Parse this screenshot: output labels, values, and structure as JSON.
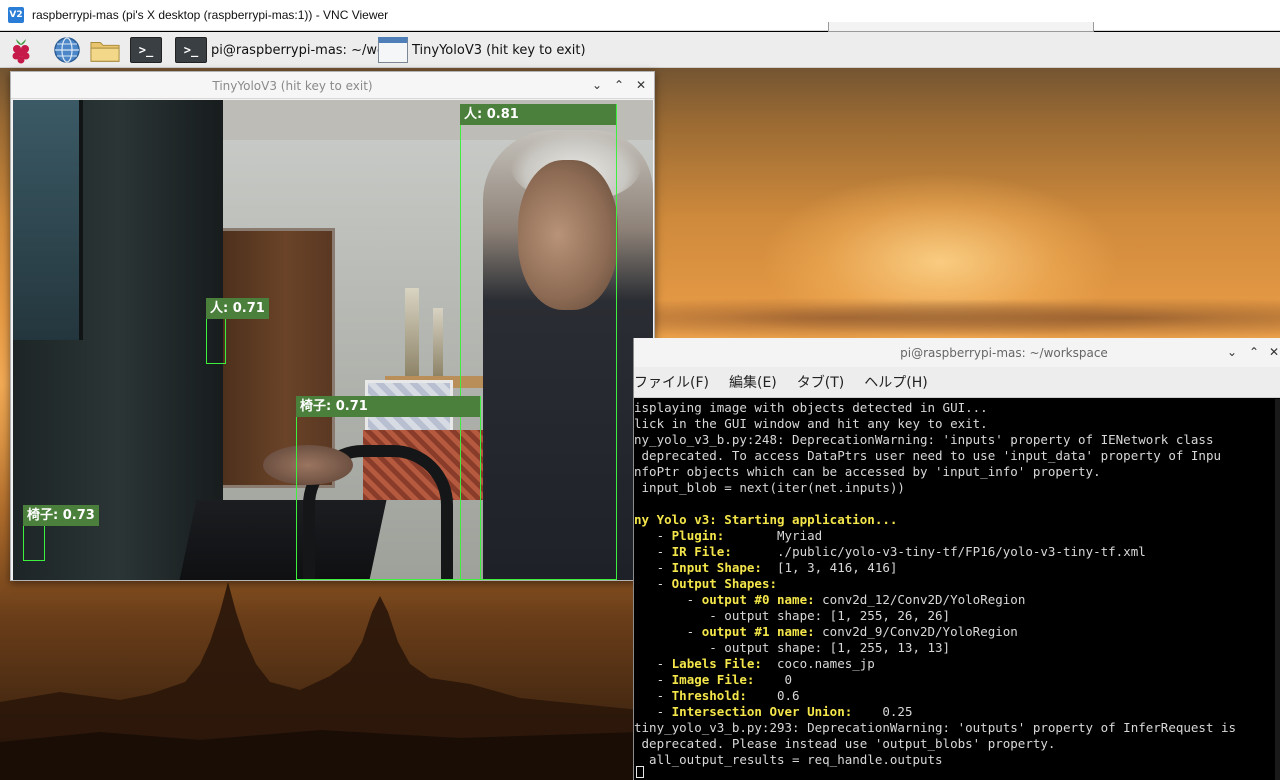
{
  "vnc": {
    "title": "raspberrypi-mas (pi's X desktop (raspberrypi-mas:1)) - VNC Viewer",
    "logo_text": "V2"
  },
  "taskbar": {
    "terminal_glyph": ">_",
    "terminal_window_label": "pi@raspberrypi-mas: ~/wo...",
    "yolo_window_label": "TinyYoloV3 (hit key to exit)"
  },
  "yolo_window": {
    "title": "TinyYoloV3 (hit key to exit)",
    "controls": {
      "minimize": "⌄",
      "maximize": "⌃",
      "close": "✕"
    },
    "detections": [
      {
        "label": "人: 0.81"
      },
      {
        "label": "人: 0.71"
      },
      {
        "label": "椅子: 0.71"
      },
      {
        "label": "椅子: 0.73"
      }
    ],
    "detection_color": "#3df03d",
    "label_bg": "#4b7f3c"
  },
  "terminal": {
    "title": "pi@raspberrypi-mas: ~/workspace",
    "controls": {
      "minimize": "⌄",
      "maximize": "⌃",
      "close": "✕"
    },
    "menu": [
      "ファイル(F)",
      "編集(E)",
      "タブ(T)",
      "ヘルプ(H)"
    ],
    "lines": [
      {
        "prefix": "",
        "hl": "",
        "rest": "isplaying image with objects detected in GUI..."
      },
      {
        "prefix": "",
        "hl": "",
        "rest": "lick in the GUI window and hit any key to exit."
      },
      {
        "prefix": "",
        "hl": "",
        "rest": "ny_yolo_v3_b.py:248: DeprecationWarning: 'inputs' property of IENetwork class"
      },
      {
        "prefix": "",
        "hl": "",
        "rest": " deprecated. To access DataPtrs user need to use 'input_data' property of Inpu"
      },
      {
        "prefix": "",
        "hl": "",
        "rest": "nfoPtr objects which can be accessed by 'input_info' property."
      },
      {
        "prefix": "",
        "hl": "",
        "rest": " input_blob = next(iter(net.inputs))"
      },
      {
        "prefix": "",
        "hl": "",
        "rest": ""
      },
      {
        "prefix": "",
        "hl": "ny Yolo v3: Starting application...",
        "rest": ""
      },
      {
        "prefix": "   - ",
        "hl": "Plugin:",
        "rest": "       Myriad"
      },
      {
        "prefix": "   - ",
        "hl": "IR File:",
        "rest": "      ./public/yolo-v3-tiny-tf/FP16/yolo-v3-tiny-tf.xml"
      },
      {
        "prefix": "   - ",
        "hl": "Input Shape:",
        "rest": "  [1, 3, 416, 416]"
      },
      {
        "prefix": "   - ",
        "hl": "Output Shapes:",
        "rest": ""
      },
      {
        "prefix": "       - ",
        "hl": "output #0 name:",
        "rest": " conv2d_12/Conv2D/YoloRegion"
      },
      {
        "prefix": "",
        "hl": "",
        "rest": "          - output shape: [1, 255, 26, 26]"
      },
      {
        "prefix": "       - ",
        "hl": "output #1 name:",
        "rest": " conv2d_9/Conv2D/YoloRegion"
      },
      {
        "prefix": "",
        "hl": "",
        "rest": "          - output shape: [1, 255, 13, 13]"
      },
      {
        "prefix": "   - ",
        "hl": "Labels File:",
        "rest": "  coco.names_jp"
      },
      {
        "prefix": "   - ",
        "hl": "Image File:",
        "rest": "    0"
      },
      {
        "prefix": "   - ",
        "hl": "Threshold:",
        "rest": "    0.6"
      },
      {
        "prefix": "   - ",
        "hl": "Intersection Over Union:",
        "rest": "    0.25"
      },
      {
        "prefix": "",
        "hl": "",
        "rest": "tiny_yolo_v3_b.py:293: DeprecationWarning: 'outputs' property of InferRequest is"
      },
      {
        "prefix": "",
        "hl": "",
        "rest": " deprecated. Please instead use 'output_blobs' property."
      },
      {
        "prefix": "",
        "hl": "",
        "rest": "  all_output_results = req_handle.outputs"
      }
    ]
  }
}
